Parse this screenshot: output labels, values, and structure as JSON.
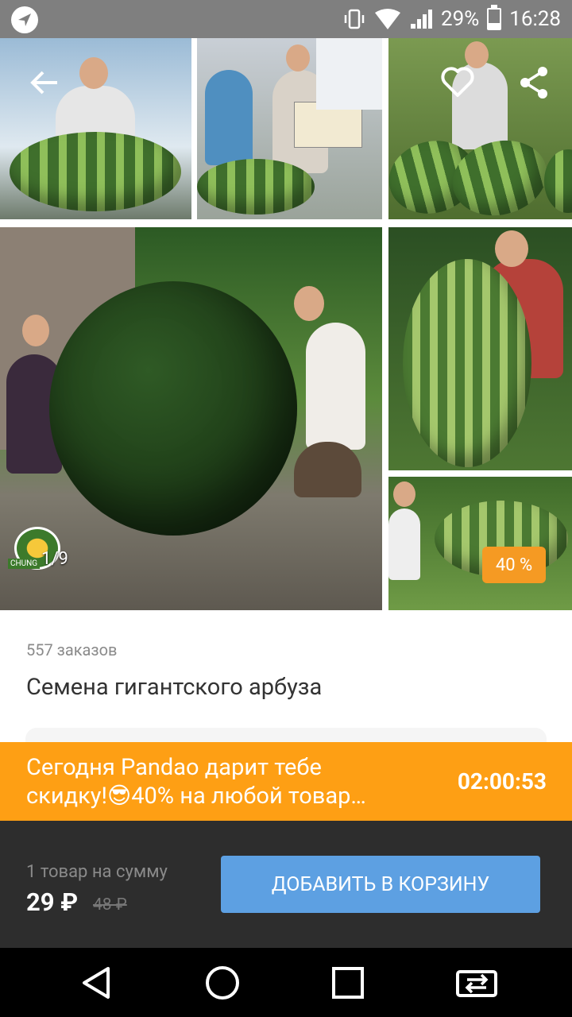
{
  "status_bar": {
    "battery": "29%",
    "time": "16:28",
    "icons": [
      "navigation-icon",
      "vibrate-icon",
      "wifi-icon",
      "signal-icon",
      "battery-icon"
    ]
  },
  "gallery": {
    "pager": "1/9",
    "brand_badge": "CHUNG",
    "discount_badge": "40 %",
    "icons": [
      "back-arrow-icon",
      "heart-icon",
      "share-icon"
    ]
  },
  "product": {
    "orders": "557 заказов",
    "title": "Семена гигантского арбуза"
  },
  "promo": {
    "line1": "Сегодня Pandao дарит тебе",
    "line2": "скидку!😎40% на любой товар…",
    "timer": "02:00:53",
    "color": "#fe9f14"
  },
  "bottom": {
    "sum_label": "1 товар на сумму",
    "price": "29 ₽",
    "old_price": "48 ₽",
    "add_button": "ДОБАВИТЬ В КОРЗИНУ",
    "button_color": "#5da0e2"
  },
  "navbar": {
    "icons": [
      "back-triangle-icon",
      "home-circle-icon",
      "recents-square-icon",
      "switch-app-icon"
    ]
  }
}
